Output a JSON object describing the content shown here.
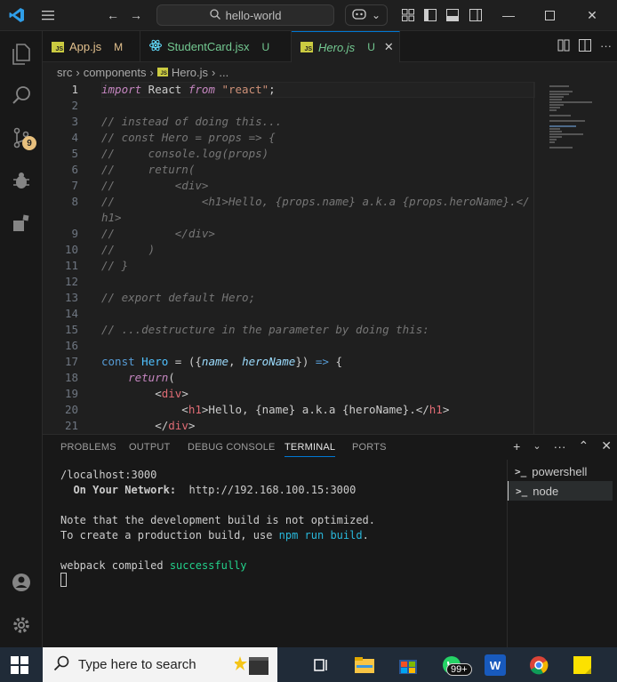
{
  "titlebar": {
    "search_text": "hello-world",
    "icons": [
      "vscode-logo-icon",
      "menu-icon",
      "arrow-left-icon",
      "arrow-right-icon",
      "search-icon",
      "copilot-icon",
      "chevron-down-icon",
      "customize-layout-icon",
      "toggle-sidebar-icon",
      "toggle-panel-icon",
      "toggle-secondary-sidebar-icon",
      "minimize-icon",
      "maximize-icon",
      "close-icon"
    ]
  },
  "activity": {
    "scm_badge": "9",
    "icons": [
      "explorer-icon",
      "search-icon",
      "source-control-icon",
      "run-debug-icon",
      "extensions-icon",
      "accounts-icon",
      "manage-gear-icon"
    ]
  },
  "tabs": [
    {
      "label": "App.js",
      "status": "M",
      "kind": "js"
    },
    {
      "label": "StudentCard.jsx",
      "status": "U",
      "kind": "react"
    },
    {
      "label": "Hero.js",
      "status": "U",
      "kind": "js",
      "active": true
    }
  ],
  "breadcrumb": {
    "parts": [
      "src",
      "components",
      "Hero.js",
      "..."
    ]
  },
  "editor": {
    "lines": [
      {
        "n": "1",
        "text": "import React from \"react\";"
      },
      {
        "n": "2",
        "text": ""
      },
      {
        "n": "3",
        "text": "// instead of doing this..."
      },
      {
        "n": "4",
        "text": "// const Hero = props => {"
      },
      {
        "n": "5",
        "text": "//     console.log(props)"
      },
      {
        "n": "6",
        "text": "//     return("
      },
      {
        "n": "7",
        "text": "//         <div>"
      },
      {
        "n": "8",
        "text": "//             <h1>Hello, {props.name} a.k.a {props.heroName}.</"
      },
      {
        "n": "",
        "text": "h1>"
      },
      {
        "n": "9",
        "text": "//         </div>"
      },
      {
        "n": "10",
        "text": "//     )"
      },
      {
        "n": "11",
        "text": "// }"
      },
      {
        "n": "12",
        "text": ""
      },
      {
        "n": "13",
        "text": "// export default Hero;"
      },
      {
        "n": "14",
        "text": ""
      },
      {
        "n": "15",
        "text": "// ...destructure in the parameter by doing this:"
      },
      {
        "n": "16",
        "text": ""
      },
      {
        "n": "17",
        "text": "const Hero = ({name, heroName}) => {"
      },
      {
        "n": "18",
        "text": "    return("
      },
      {
        "n": "19",
        "text": "        <div>"
      },
      {
        "n": "20",
        "text": "            <h1>Hello, {name} a.k.a {heroName}.</h1>"
      },
      {
        "n": "21",
        "text": "        </div>"
      }
    ]
  },
  "panel": {
    "tabs": [
      "PROBLEMS",
      "OUTPUT",
      "DEBUG CONSOLE",
      "TERMINAL",
      "PORTS"
    ],
    "active_tab": "TERMINAL",
    "terminal_lines": {
      "l1": "/localhost:3000",
      "l2_label": "  On Your Network:",
      "l2_url": "  http://192.168.100.15:3000",
      "l4": "Note that the development build is not optimized.",
      "l5_a": "To create a production build, use ",
      "l5_b": "npm run build",
      "l5_c": ".",
      "l7_a": "webpack compiled ",
      "l7_b": "successfully"
    },
    "terminals": [
      "powershell",
      "node"
    ],
    "selected_terminal": "node"
  },
  "taskbar": {
    "search_placeholder": "Type here to search",
    "whatsapp_badge": "99+",
    "icons": [
      "windows-start-icon",
      "search-icon",
      "media-icon",
      "task-view-icon",
      "file-explorer-icon",
      "store-icon",
      "whatsapp-icon",
      "word-icon",
      "chrome-icon",
      "sticky-notes-icon"
    ]
  }
}
